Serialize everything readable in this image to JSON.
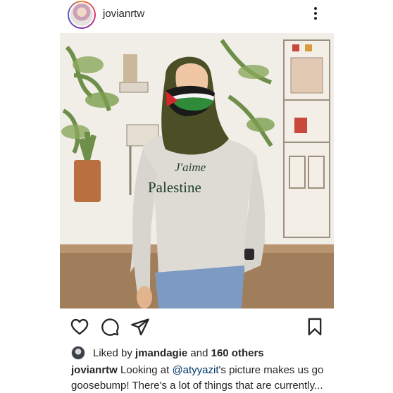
{
  "post": {
    "username": "jovianrtw",
    "photo": {
      "shirt_line1": "J'aime",
      "shirt_line2": "Palestine"
    },
    "likes": {
      "prefix": "Liked by",
      "liker": "jmandagie",
      "middle": "and",
      "others": "160 others"
    },
    "caption": {
      "user": "jovianrtw",
      "text_before": "Looking at",
      "mention": "@atyyazit",
      "text_after": "'s picture makes us go goosebump! There's a lot of things that are currently..."
    },
    "icons": {
      "more": "more-vertical-icon",
      "like": "heart-icon",
      "comment": "comment-icon",
      "share": "share-icon",
      "save": "bookmark-icon"
    }
  }
}
